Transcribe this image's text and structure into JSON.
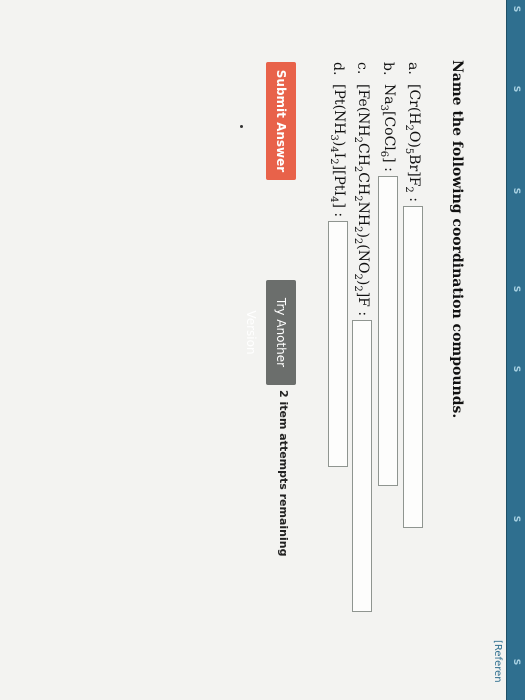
{
  "sidebar": {
    "tabs": [
      "S",
      "S",
      "S",
      "S",
      "S",
      "S",
      "S"
    ]
  },
  "header": {
    "references_label": "[Referen"
  },
  "question": {
    "instruction": "Name the following coordination compounds.",
    "items": [
      {
        "letter": "a.",
        "formula_html": "[Cr(H<sub>2</sub>O)<sub>5</sub>Br]F<sub>2</sub> :"
      },
      {
        "letter": "b.",
        "formula_html": "Na<sub>3</sub>[CoCl<sub>6</sub>] :"
      },
      {
        "letter": "c.",
        "formula_html": "[Fe(NH<sub>2</sub>CH<sub>2</sub>CH<sub>2</sub>NH<sub>2</sub>)<sub>2</sub>(NO<sub>2</sub>)<sub>2</sub>]F :"
      },
      {
        "letter": "d.",
        "formula_html": "[Pt(NH<sub>3</sub>)<sub>4</sub>I<sub>2</sub>][PtI<sub>4</sub>] :"
      }
    ],
    "answers": [
      "",
      "",
      "",
      ""
    ]
  },
  "actions": {
    "submit_label": "Submit Answer",
    "try_another_label": "Try Another Version",
    "attempts_text": "2 item attempts remaining"
  },
  "colors": {
    "submit": "#e8624a",
    "try_another": "#6b6e6c",
    "sidebar": "#2f6f8f"
  }
}
